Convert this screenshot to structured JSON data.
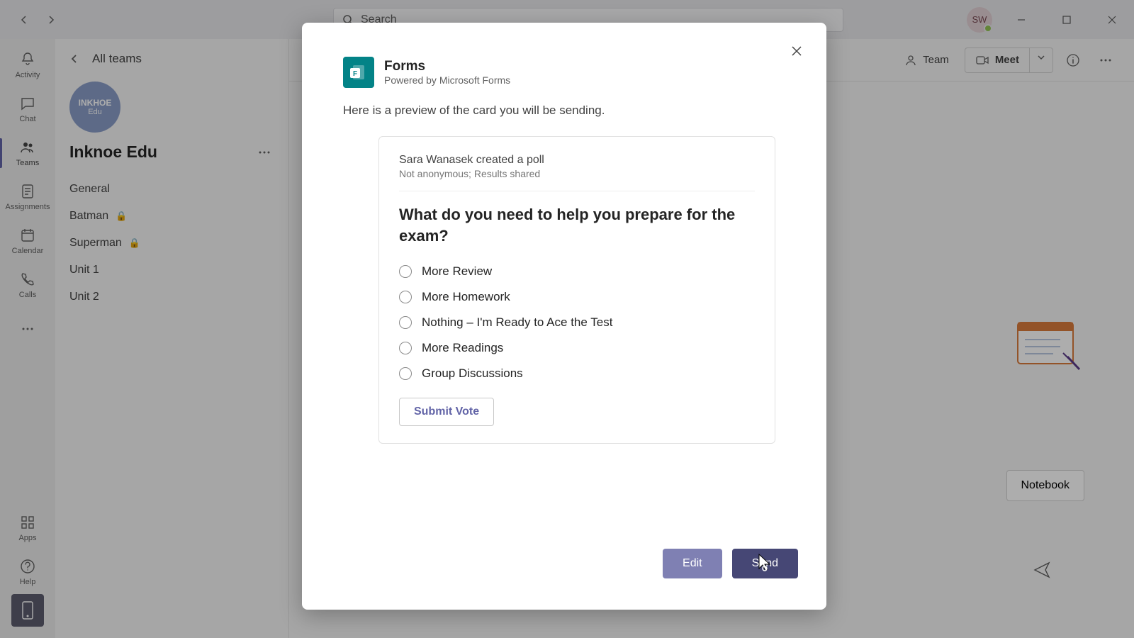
{
  "titlebar": {
    "search_placeholder": "Search",
    "avatar_initials": "SW"
  },
  "rail": {
    "items": [
      {
        "label": "Activity"
      },
      {
        "label": "Chat"
      },
      {
        "label": "Teams"
      },
      {
        "label": "Assignments"
      },
      {
        "label": "Calendar"
      },
      {
        "label": "Calls"
      }
    ],
    "more_label": "",
    "apps_label": "Apps",
    "help_label": "Help"
  },
  "sidebar": {
    "back_label": "All teams",
    "team_avatar_line1": "INKHOE",
    "team_avatar_line2": "Edu",
    "team_name": "Inknoe Edu",
    "channels": [
      {
        "label": "General",
        "locked": false
      },
      {
        "label": "Batman",
        "locked": true
      },
      {
        "label": "Superman",
        "locked": true
      },
      {
        "label": "Unit 1",
        "locked": false
      },
      {
        "label": "Unit 2",
        "locked": false
      }
    ]
  },
  "header": {
    "team_label": "Team",
    "meet_label": "Meet"
  },
  "main": {
    "notebook_label": "Notebook"
  },
  "modal": {
    "title": "Forms",
    "subtitle": "Powered by Microsoft Forms",
    "description": "Here is a preview of the card you will be sending.",
    "poll": {
      "creator_line": "Sara Wanasek created a poll",
      "meta_line": "Not anonymous; Results shared",
      "question": "What do you need to help you prepare for the exam?",
      "options": [
        "More Review",
        "More Homework",
        "Nothing – I'm Ready to Ace the Test",
        "More Readings",
        "Group Discussions"
      ],
      "submit_label": "Submit Vote"
    },
    "edit_label": "Edit",
    "send_label": "Send"
  }
}
